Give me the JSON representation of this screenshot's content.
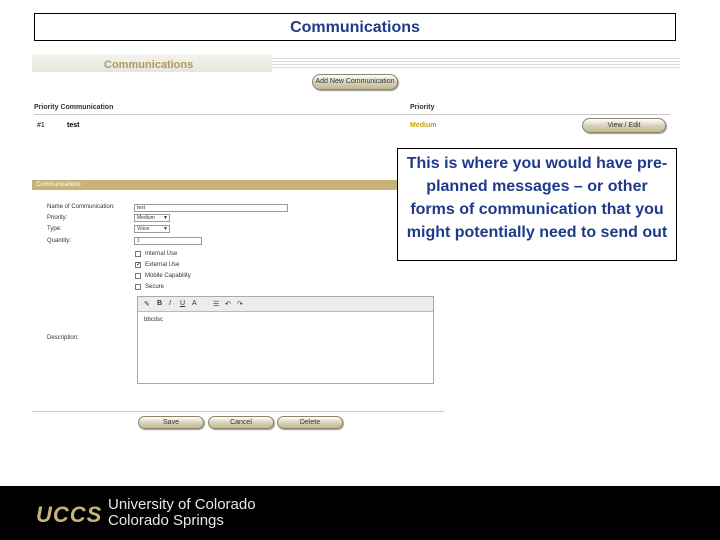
{
  "slide": {
    "title": "Communications"
  },
  "app": {
    "section_title": "Communications",
    "add_button": "Add New Communication",
    "table": {
      "headers": {
        "priority_communication": "Priority Communication",
        "priority": "Priority"
      },
      "rows": [
        {
          "number": "#1",
          "name": "test",
          "priority": "Medium",
          "action": "View / Edit"
        }
      ]
    },
    "form": {
      "header": "Communications",
      "name_label": "Name of Communication:",
      "name_value": "test",
      "priority_label": "Priority:",
      "priority_value": "Medium",
      "type_label": "Type:",
      "type_value": "Voice",
      "quantity_label": "Quantity:",
      "quantity_value": "1",
      "checkboxes": [
        {
          "label": "Internal Use",
          "checked": false
        },
        {
          "label": "External Use",
          "checked": true
        },
        {
          "label": "Mobile Capability",
          "checked": false
        },
        {
          "label": "Secure",
          "checked": false
        }
      ],
      "description_label": "Description:",
      "description_value": "bbcdsc",
      "toolbar": {
        "bold": "B",
        "italic": "I",
        "underline": "U",
        "font": "A"
      },
      "save": "Save",
      "cancel": "Cancel",
      "delete": "Delete"
    }
  },
  "callout": {
    "text": "This is where you would have pre-planned messages – or other forms of communication that you might potentially need to send out"
  },
  "footer": {
    "logo": "UCCS",
    "line1": "University of Colorado",
    "line2": "Colorado Springs"
  },
  "colors": {
    "title_blue": "#1f3a8a",
    "gold": "#c8b27a",
    "medium_orange": "#d49a00"
  }
}
